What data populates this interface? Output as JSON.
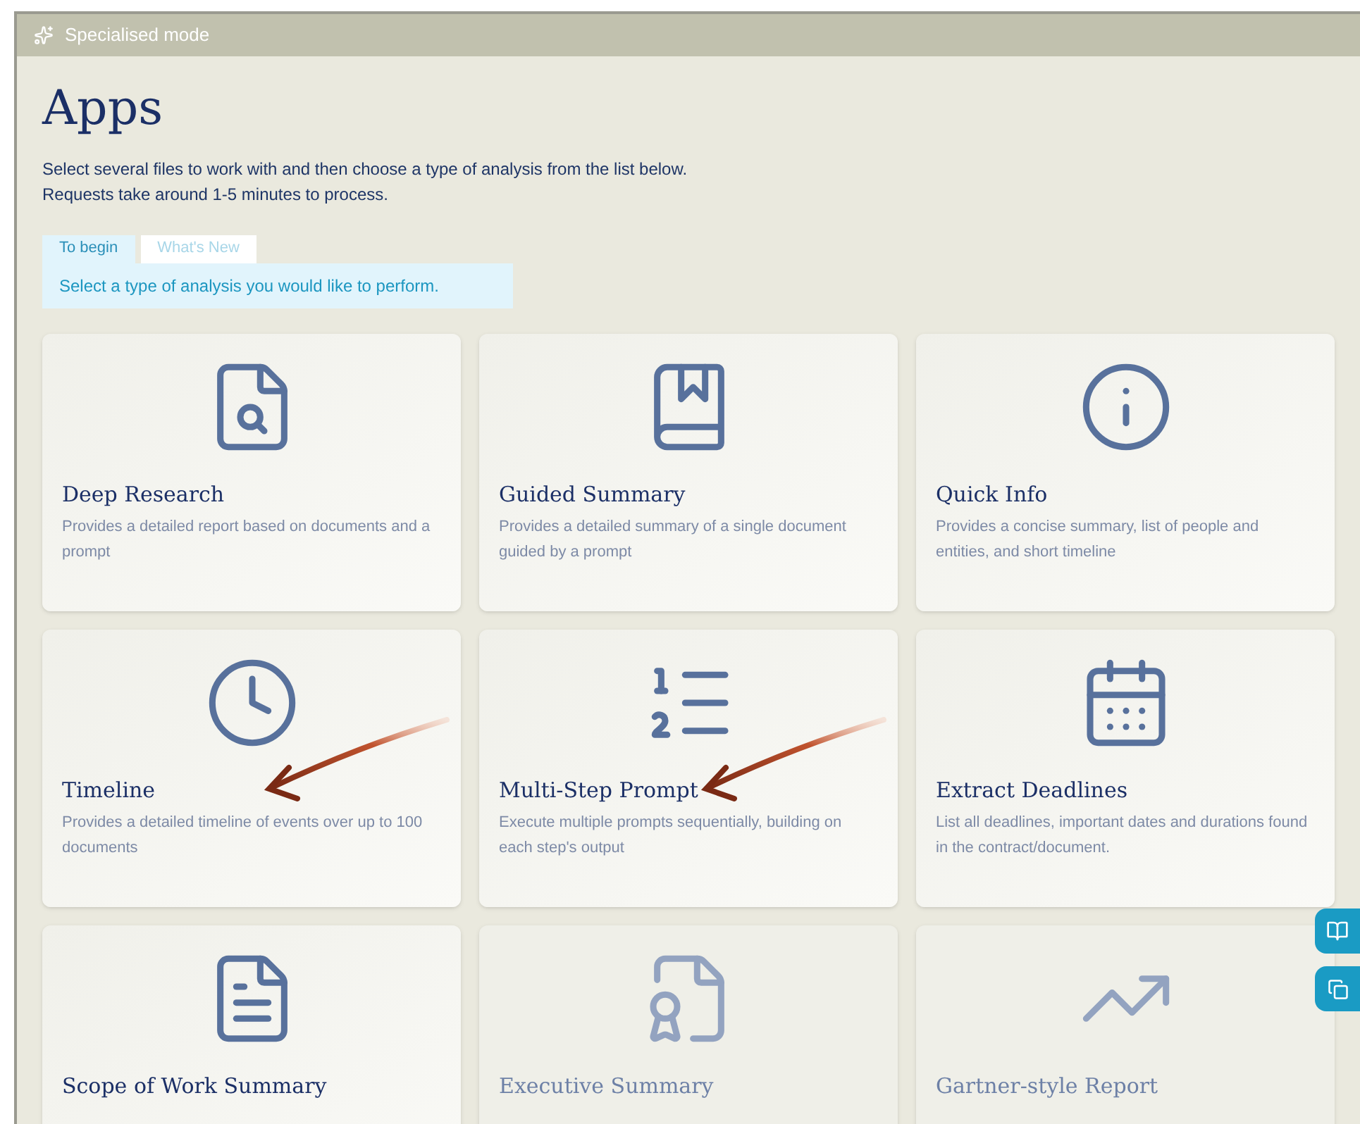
{
  "window": {
    "title": "Specialised mode"
  },
  "heading": "Apps",
  "intro": [
    "Select several files to work with and then choose a type of analysis from the list below.",
    "Requests take around 1-5 minutes to process."
  ],
  "tabs": [
    {
      "label": "To begin",
      "selected": true
    },
    {
      "label": "What's New",
      "selected": false
    }
  ],
  "tab_panel": "Select a type of analysis you would like to perform.",
  "apps": [
    {
      "title": "Deep Research",
      "description": "Provides a detailed report based on documents and a prompt",
      "disabled": false,
      "annotated": false
    },
    {
      "title": "Guided Summary",
      "description": "Provides a detailed summary of a single document guided by a prompt",
      "disabled": false,
      "annotated": false
    },
    {
      "title": "Quick Info",
      "description": "Provides a concise summary, list of people and entities, and short timeline",
      "disabled": false,
      "annotated": false
    },
    {
      "title": "Timeline",
      "description": "Provides a detailed timeline of events over up to 100 documents",
      "disabled": false,
      "annotated": true
    },
    {
      "title": "Multi-Step Prompt",
      "description": "Execute multiple prompts sequentially, building on each step's output",
      "disabled": false,
      "annotated": true
    },
    {
      "title": "Extract Deadlines",
      "description": "List all deadlines, important dates and durations found in the contract/document.",
      "disabled": false,
      "annotated": false
    },
    {
      "title": "Scope of Work Summary",
      "disabled": false,
      "annotated": false
    },
    {
      "title": "Executive Summary",
      "disabled": true,
      "annotated": false
    },
    {
      "title": "Gartner-style Report",
      "disabled": true,
      "annotated": false
    }
  ]
}
